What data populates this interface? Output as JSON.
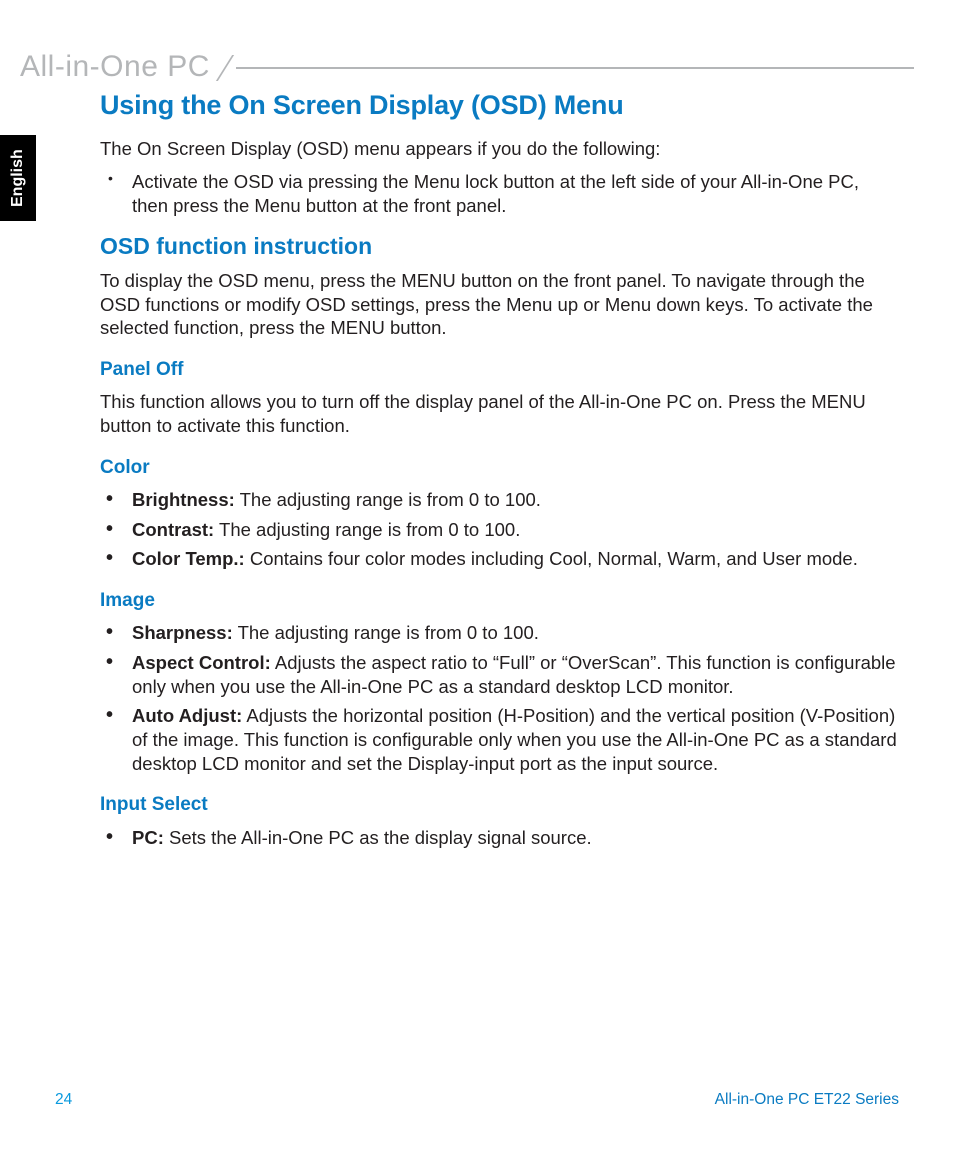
{
  "header": {
    "product_line": "All-in-One PC"
  },
  "language_tab": "English",
  "main": {
    "h1": "Using the On Screen Display (OSD) Menu",
    "intro": "The On Screen Display (OSD) menu appears if you do the following:",
    "intro_bullets": [
      "Activate the OSD via pressing the Menu lock button at the left side of your All-in-One PC, then press the Menu button at the front panel."
    ],
    "h2": "OSD function instruction",
    "h2_body": "To display the OSD menu, press the MENU button on the front panel. To navigate through the OSD functions or modify OSD settings, press the Menu up or Menu down keys. To activate the selected function, press the MENU button.",
    "sections": {
      "panel_off": {
        "title": "Panel Off",
        "body": "This function allows you to turn off the display panel of the All-in-One PC on. Press the MENU button to activate this function."
      },
      "color": {
        "title": "Color",
        "items": [
          {
            "label": "Brightness:",
            "text": " The adjusting range is from 0 to 100."
          },
          {
            "label": "Contrast:",
            "text": " The adjusting range is from 0 to 100."
          },
          {
            "label": "Color Temp.:",
            "text": " Contains four color modes including Cool, Normal, Warm, and User mode."
          }
        ]
      },
      "image": {
        "title": "Image",
        "items": [
          {
            "label": "Sharpness:",
            "text": " The adjusting range is from 0 to 100."
          },
          {
            "label": "Aspect Control:",
            "text": " Adjusts the aspect ratio to “Full” or “OverScan”. This function is configurable only when you use the All-in-One PC as a standard desktop LCD monitor."
          },
          {
            "label": "Auto Adjust:",
            "text": " Adjusts the horizontal position (H-Position) and the vertical position (V-Position) of the image. This function is configurable only when you use the All-in-One PC as a standard desktop LCD monitor and set the Display-input port as the input source."
          }
        ]
      },
      "input_select": {
        "title": "Input Select",
        "items": [
          {
            "label": "PC:",
            "text": " Sets the All-in-One PC as the display signal source."
          }
        ]
      }
    }
  },
  "footer": {
    "page_number": "24",
    "series": "All-in-One PC ET22 Series"
  }
}
